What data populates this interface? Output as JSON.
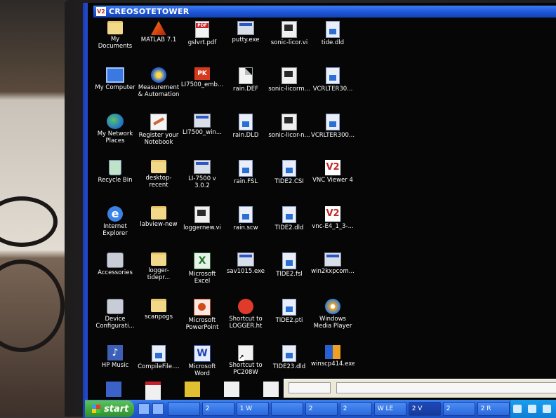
{
  "window": {
    "logo": "V2",
    "title": "CREOSOTETOWER"
  },
  "desktop_icons": [
    {
      "label": "My Documents",
      "icon": "my-documents-icon",
      "kind": "folder"
    },
    {
      "label": "MATLAB 7.1",
      "icon": "matlab-icon",
      "kind": "matlab"
    },
    {
      "label": "gslvrt.pdf",
      "icon": "pdf-icon",
      "kind": "pdf"
    },
    {
      "label": "putty.exe",
      "icon": "putty-icon",
      "kind": "exe"
    },
    {
      "label": "sonic-licor.vi",
      "icon": "labview-vi-icon",
      "kind": "vi"
    },
    {
      "label": "tide.dld",
      "icon": "file-icon",
      "kind": "bluedoc"
    },
    {
      "label": "My Computer",
      "icon": "my-computer-icon",
      "kind": "pc"
    },
    {
      "label": "Measurement & Automation",
      "icon": "measurement-automation-icon",
      "kind": "measure"
    },
    {
      "label": "LI7500_emb...",
      "icon": "pk-archive-icon",
      "kind": "pk"
    },
    {
      "label": "rain.DEF",
      "icon": "file-icon",
      "kind": "doc"
    },
    {
      "label": "sonic-licorm...",
      "icon": "labview-vi-icon",
      "kind": "vi"
    },
    {
      "label": "VCRLTER30...",
      "icon": "file-icon",
      "kind": "bluedoc"
    },
    {
      "label": "My Network Places",
      "icon": "network-places-icon",
      "kind": "net"
    },
    {
      "label": "Register your Notebook",
      "icon": "register-notebook-icon",
      "kind": "regnote"
    },
    {
      "label": "LI7500_win...",
      "icon": "installer-icon",
      "kind": "exe"
    },
    {
      "label": "rain.DLD",
      "icon": "file-icon",
      "kind": "bluedoc"
    },
    {
      "label": "sonic-licor-n...",
      "icon": "labview-vi-icon",
      "kind": "vi"
    },
    {
      "label": "VCRLTER300...",
      "icon": "file-icon",
      "kind": "bluedoc"
    },
    {
      "label": "Recycle Bin",
      "icon": "recycle-bin-icon",
      "kind": "bin"
    },
    {
      "label": "desktop-recent",
      "icon": "folder-icon",
      "kind": "folder"
    },
    {
      "label": "LI-7500 v 3.0.2",
      "icon": "licor-app-icon",
      "kind": "exe"
    },
    {
      "label": "rain.FSL",
      "icon": "file-icon",
      "kind": "bluedoc"
    },
    {
      "label": "TIDE2.CSI",
      "icon": "file-icon",
      "kind": "bluedoc"
    },
    {
      "label": "VNC Viewer 4",
      "icon": "vnc-viewer-icon",
      "kind": "vnc"
    },
    {
      "label": "Internet Explorer",
      "icon": "internet-explorer-icon",
      "kind": "ie"
    },
    {
      "label": "labview-new",
      "icon": "folder-icon",
      "kind": "folder"
    },
    {
      "label": "loggernew.vi",
      "icon": "labview-vi-icon",
      "kind": "vi"
    },
    {
      "label": "rain.scw",
      "icon": "file-icon",
      "kind": "bluedoc"
    },
    {
      "label": "TIDE2.dld",
      "icon": "file-icon",
      "kind": "bluedoc"
    },
    {
      "label": "vnc-E4_1_3-...",
      "icon": "vnc-installer-icon",
      "kind": "vnc"
    },
    {
      "label": "Accessories",
      "icon": "accessories-icon",
      "kind": "tool"
    },
    {
      "label": "logger-tidepr...",
      "icon": "folder-icon",
      "kind": "folder"
    },
    {
      "label": "Microsoft Excel",
      "icon": "excel-icon",
      "kind": "xl"
    },
    {
      "label": "sav1015.exe",
      "icon": "installer-icon",
      "kind": "exe"
    },
    {
      "label": "TIDE2.fsl",
      "icon": "file-icon",
      "kind": "bluedoc"
    },
    {
      "label": "win2kxpcom...",
      "icon": "installer-icon",
      "kind": "exe"
    },
    {
      "label": "Device Configurati...",
      "icon": "device-config-icon",
      "kind": "tool"
    },
    {
      "label": "scanpogs",
      "icon": "folder-icon",
      "kind": "folder"
    },
    {
      "label": "Microsoft PowerPoint",
      "icon": "powerpoint-icon",
      "kind": "ppt"
    },
    {
      "label": "Shortcut to LOGGER.ht",
      "icon": "logger-shortcut-icon",
      "kind": "logger"
    },
    {
      "label": "TIDE2.pti",
      "icon": "file-icon",
      "kind": "bluedoc"
    },
    {
      "label": "Windows Media Player",
      "icon": "media-player-icon",
      "kind": "wmp"
    },
    {
      "label": "HP Music",
      "icon": "hp-music-icon",
      "kind": "music"
    },
    {
      "label": "CompileFile....",
      "icon": "file-icon",
      "kind": "bluedoc"
    },
    {
      "label": "Microsoft Word",
      "icon": "word-icon",
      "kind": "word"
    },
    {
      "label": "Shortcut to PC208W",
      "icon": "shortcut-icon",
      "kind": "shortcut"
    },
    {
      "label": "TIDE23.dld",
      "icon": "file-icon",
      "kind": "bluedoc"
    },
    {
      "label": "winscp414.exe",
      "icon": "winscp-icon",
      "kind": "scp"
    }
  ],
  "taskbar": {
    "start_label": "start",
    "tasks": [
      {
        "label": ""
      },
      {
        "label": "2"
      },
      {
        "label": "1 W"
      },
      {
        "label": ""
      },
      {
        "label": "2"
      },
      {
        "label": "2"
      },
      {
        "label": "W LE"
      },
      {
        "label": "2 V"
      },
      {
        "label": "2"
      },
      {
        "label": "2 R"
      }
    ]
  }
}
